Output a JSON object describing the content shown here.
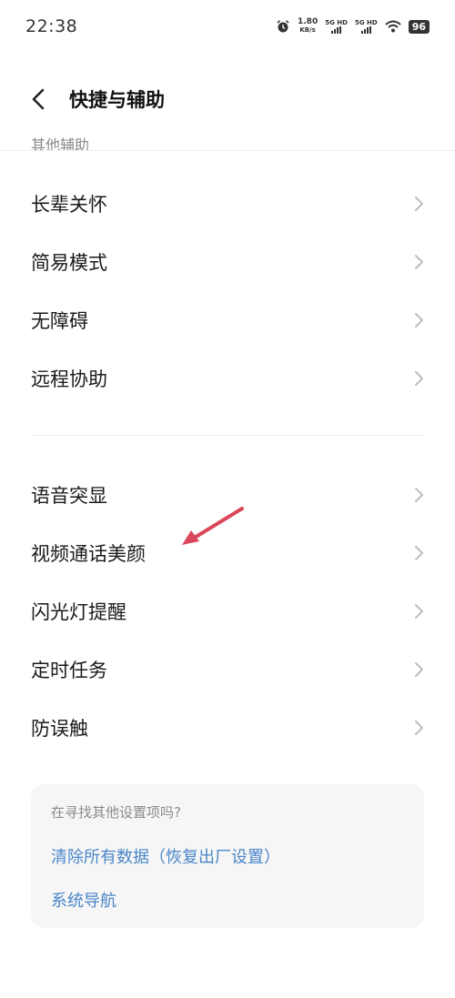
{
  "status_bar": {
    "time": "22:38",
    "speed_value": "1.80",
    "speed_unit": "KB/s",
    "sim1_label": "5G HD",
    "sim2_label": "5G HD",
    "battery": "96"
  },
  "header": {
    "title": "快捷与辅助"
  },
  "partial_section_label": "其他辅助",
  "groups": [
    {
      "items": [
        {
          "label": "长辈关怀"
        },
        {
          "label": "简易模式"
        },
        {
          "label": "无障碍"
        },
        {
          "label": "远程协助"
        }
      ]
    },
    {
      "items": [
        {
          "label": "语音突显"
        },
        {
          "label": "视频通话美颜"
        },
        {
          "label": "闪光灯提醒"
        },
        {
          "label": "定时任务"
        },
        {
          "label": "防误触"
        }
      ]
    }
  ],
  "suggestion_card": {
    "hint": "在寻找其他设置项吗?",
    "links": [
      {
        "label": "清除所有数据（恢复出厂设置）"
      },
      {
        "label": "系统导航"
      }
    ]
  },
  "colors": {
    "link": "#4a86c8",
    "annotation_arrow": "#d9485a",
    "card_bg": "#f6f6f6"
  }
}
